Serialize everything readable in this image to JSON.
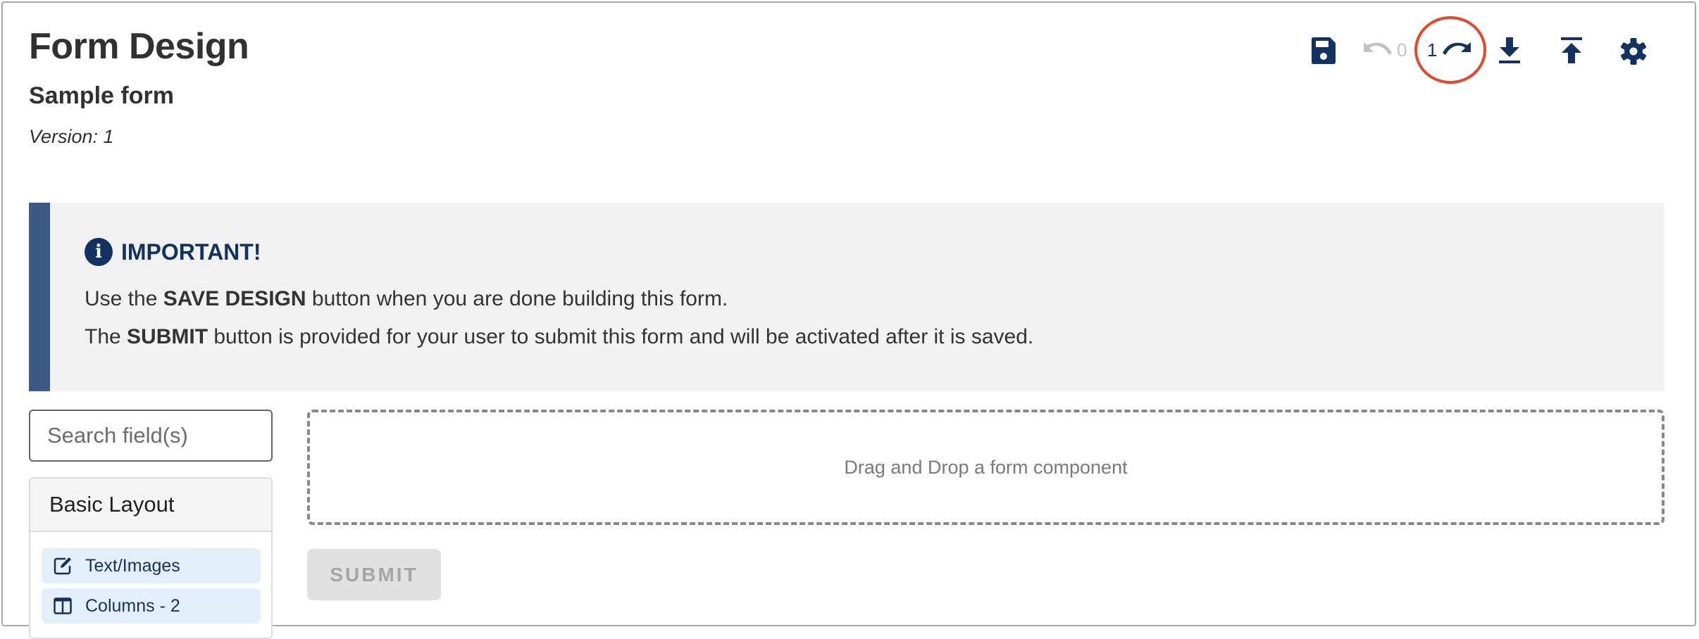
{
  "header": {
    "title": "Form Design",
    "form_name": "Sample form",
    "version": "Version: 1"
  },
  "toolbar": {
    "save_icon": "floppy-disk-icon",
    "undo_icon": "undo-icon",
    "undo_count": "0",
    "redo_count": "1",
    "redo_icon": "redo-icon",
    "download_icon": "download-icon",
    "upload_icon": "upload-icon",
    "settings_icon": "gear-icon",
    "highlight_color": "#e5472b",
    "icon_color": "#123262",
    "disabled_color": "#c2c2c2"
  },
  "banner": {
    "icon": "info-circle-icon",
    "title": "IMPORTANT!",
    "line1_pre": "Use the ",
    "line1_bold": "SAVE DESIGN",
    "line1_post": " button when you are done building this form.",
    "line2_pre": "The ",
    "line2_bold": "SUBMIT",
    "line2_post": " button is provided for your user to submit this form and will be activated after it is saved.",
    "accent_color": "#3d5a86"
  },
  "sidebar": {
    "search_placeholder": "Search field(s)",
    "search_value": "",
    "panel_title": "Basic Layout",
    "items": [
      {
        "label": "Text/Images",
        "icon": "edit-icon"
      },
      {
        "label": "Columns - 2",
        "icon": "columns-icon"
      }
    ]
  },
  "canvas": {
    "dropzone_text": "Drag and Drop a form component",
    "submit_label": "SUBMIT",
    "submit_disabled": true
  }
}
